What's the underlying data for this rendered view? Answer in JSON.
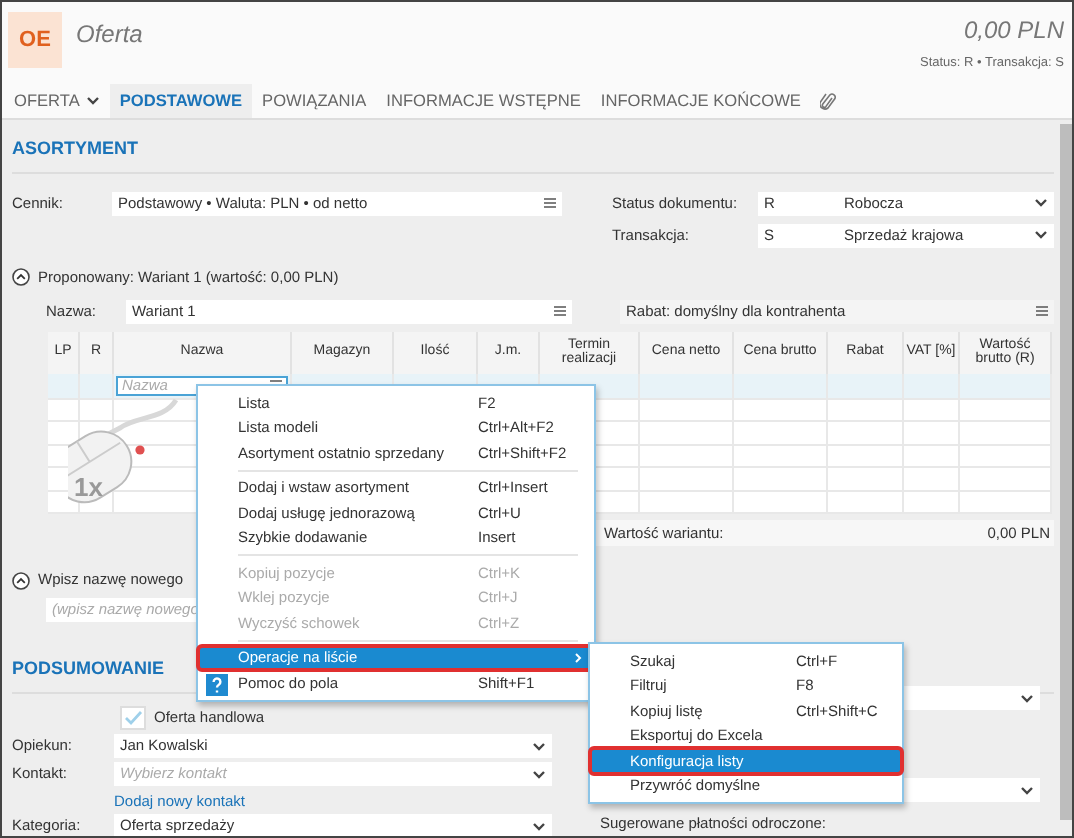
{
  "header": {
    "badge": "OE",
    "title": "Oferta",
    "amount": "0,00 PLN",
    "status_line": "Status: R • Transakcja: S"
  },
  "tabs": [
    {
      "label": "OFERTA",
      "selected": false,
      "kind": "dropdown"
    },
    {
      "label": "PODSTAWOWE",
      "selected": true,
      "kind": "tab"
    },
    {
      "label": "POWIĄZANIA",
      "selected": false,
      "kind": "tab"
    },
    {
      "label": "INFORMACJE WSTĘPNE",
      "selected": false,
      "kind": "tab"
    },
    {
      "label": "INFORMACJE KOŃCOWE",
      "selected": false,
      "kind": "tab"
    },
    {
      "selected": false,
      "kind": "attachments"
    }
  ],
  "assortment": {
    "heading": "ASORTYMENT",
    "price_list": {
      "label": "Cennik:",
      "value": "Podstawowy • Waluta: PLN • od netto"
    },
    "document_status": {
      "label": "Status dokumentu:",
      "code": "R",
      "value": "Robocza"
    },
    "transaction": {
      "label": "Transakcja:",
      "code": "S",
      "value": "Sprzedaż krajowa"
    }
  },
  "variant": {
    "title": "Proponowany: Wariant 1 (wartość: 0,00 PLN)",
    "name_label": "Nazwa:",
    "name_value": "Wariant 1",
    "discount": "Rabat: domyślny dla kontrahenta"
  },
  "table": {
    "columns": [
      "LP",
      "R",
      "Nazwa",
      "Magazyn",
      "Ilość",
      "J.m.",
      "Termin realizacji",
      "Cena netto",
      "Cena brutto",
      "Rabat",
      "VAT [%]",
      "Wartość brutto (R)"
    ],
    "new_row_placeholder": "Nazwa",
    "total_label": "Wartość wariantu:",
    "total_value": "0,00 PLN"
  },
  "new_variant": {
    "title": "Wpisz nazwę nowego",
    "placeholder": "(wpisz nazwę nowego"
  },
  "summary": {
    "heading": "PODSUMOWANIE",
    "offer_checkbox": {
      "label": "Oferta handlowa",
      "checked": true
    },
    "fields": [
      {
        "label": "Opiekun:",
        "value": "Jan Kowalski"
      },
      {
        "label": "Kontakt:",
        "placeholder": "Wybierz kontakt"
      }
    ],
    "add_contact_link": "Dodaj nowy kontakt",
    "category": {
      "label": "Kategoria:",
      "value": "Oferta sprzedaży"
    },
    "deferred_label": "Sugerowane płatności odroczone:"
  },
  "mouse_hint": "1x",
  "context_menu": [
    {
      "kind": "item",
      "label": "Lista",
      "shortcut": "F2",
      "disabled": false,
      "selected": false,
      "outlined": false
    },
    {
      "kind": "item",
      "label": "Lista modeli",
      "shortcut": "Ctrl+Alt+F2",
      "disabled": false,
      "selected": false,
      "outlined": false
    },
    {
      "kind": "item",
      "label": "Asortyment ostatnio sprzedany",
      "shortcut": "Ctrl+Shift+F2",
      "disabled": false,
      "selected": false,
      "outlined": false
    },
    {
      "kind": "separator"
    },
    {
      "kind": "item",
      "label": "Dodaj i wstaw asortyment",
      "shortcut": "Ctrl+Insert",
      "disabled": false,
      "selected": false,
      "outlined": false
    },
    {
      "kind": "item",
      "label": "Dodaj usługę jednorazową",
      "shortcut": "Ctrl+U",
      "disabled": false,
      "selected": false,
      "outlined": false
    },
    {
      "kind": "item",
      "label": "Szybkie dodawanie",
      "shortcut": "Insert",
      "disabled": false,
      "selected": false,
      "outlined": false
    },
    {
      "kind": "separator"
    },
    {
      "kind": "item",
      "label": "Kopiuj pozycje",
      "shortcut": "Ctrl+K",
      "disabled": true,
      "selected": false,
      "outlined": false
    },
    {
      "kind": "item",
      "label": "Wklej pozycje",
      "shortcut": "Ctrl+J",
      "disabled": true,
      "selected": false,
      "outlined": false
    },
    {
      "kind": "item",
      "label": "Wyczyść schowek",
      "shortcut": "Ctrl+Z",
      "disabled": true,
      "selected": false,
      "outlined": false
    },
    {
      "kind": "separator"
    },
    {
      "kind": "submenu",
      "label": "Operacje na liście",
      "disabled": false,
      "selected": true,
      "outlined": true
    },
    {
      "kind": "help",
      "label": "Pomoc do pola",
      "shortcut": "Shift+F1",
      "disabled": false,
      "selected": false,
      "outlined": false
    }
  ],
  "submenu": [
    {
      "label": "Szukaj",
      "shortcut": "Ctrl+F",
      "selected": false,
      "outlined": false
    },
    {
      "label": "Filtruj",
      "shortcut": "F8",
      "selected": false,
      "outlined": false
    },
    {
      "label": "Kopiuj listę",
      "shortcut": "Ctrl+Shift+C",
      "selected": false,
      "outlined": false
    },
    {
      "label": "Eksportuj do Excela",
      "selected": false,
      "outlined": false
    },
    {
      "label": "Konfiguracja listy",
      "selected": true,
      "outlined": true
    },
    {
      "label": "Przywróć domyślne",
      "selected": false,
      "outlined": false
    }
  ]
}
